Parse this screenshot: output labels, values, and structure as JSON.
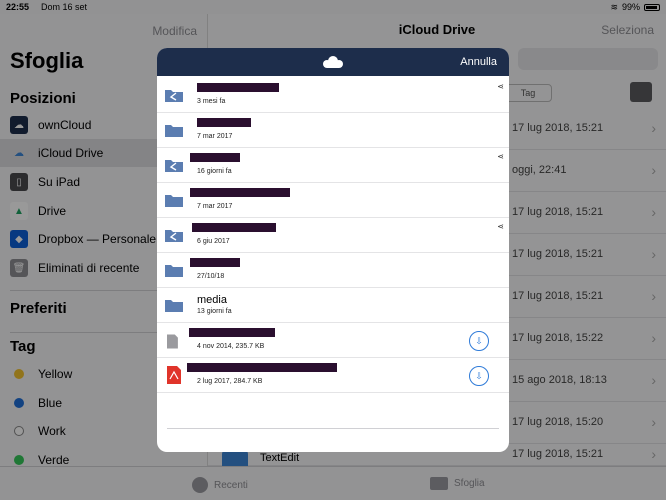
{
  "status": {
    "time": "22:55",
    "date": "Dom 16 set",
    "battery": "99%"
  },
  "sidebar": {
    "edit_label": "Modifica",
    "title": "Sfoglia",
    "locations_title": "Posizioni",
    "locations": [
      {
        "label": "ownCloud",
        "icon": "owncloud-icon"
      },
      {
        "label": "iCloud Drive",
        "icon": "icloud-icon"
      },
      {
        "label": "Su iPad",
        "icon": "ipad-icon"
      },
      {
        "label": "Drive",
        "icon": "google-drive-icon"
      },
      {
        "label": "Dropbox — Personale",
        "icon": "dropbox-icon"
      },
      {
        "label": "Eliminati di recente",
        "icon": "trash-icon"
      }
    ],
    "favorites_title": "Preferiti",
    "tags_title": "Tag",
    "tags": [
      {
        "label": "Yellow",
        "color": "#f2c12e"
      },
      {
        "label": "Blue",
        "color": "#1f6fd8"
      },
      {
        "label": "Work",
        "color": "#ffffff"
      },
      {
        "label": "Verde",
        "color": "#34c759"
      }
    ]
  },
  "main": {
    "title": "iCloud Drive",
    "select_label": "Seleziona",
    "tag_pill": "Tag",
    "rows": [
      {
        "date": "17 lug 2018, 15:21"
      },
      {
        "date": "oggi, 22:41"
      },
      {
        "date": "17 lug 2018, 15:21"
      },
      {
        "date": "17 lug 2018, 15:21"
      },
      {
        "date": "17 lug 2018, 15:21"
      },
      {
        "date": "17 lug 2018, 15:22"
      },
      {
        "date": "15 ago 2018, 18:13"
      },
      {
        "date": "17 lug 2018, 15:20"
      },
      {
        "date": "17 lug 2018, 15:21",
        "name": "TextEdit"
      }
    ]
  },
  "tabbar": {
    "recents": "Recenti",
    "browse": "Sfoglia"
  },
  "modal": {
    "cancel_label": "Annulla",
    "items": [
      {
        "kind": "shared-folder",
        "meta": "3 mesi fa"
      },
      {
        "kind": "folder",
        "meta": "7 mar 2017"
      },
      {
        "kind": "shared-folder",
        "meta": "16 giorni fa"
      },
      {
        "kind": "folder",
        "meta": "7 mar 2017"
      },
      {
        "kind": "shared-folder",
        "meta": "6 giu 2017"
      },
      {
        "kind": "folder",
        "meta": "27/10/18"
      },
      {
        "kind": "folder",
        "name": "media",
        "meta": "13 giorni fa"
      },
      {
        "kind": "file",
        "meta": "4 nov 2014, 235.7 KB"
      },
      {
        "kind": "pdf",
        "meta": "2 lug 2017, 284.7 KB"
      }
    ]
  },
  "colors": {
    "accent": "#2f7bd8",
    "header": "#1d2d4b",
    "folder": "#5b7db1",
    "pdf": "#e0342a"
  }
}
